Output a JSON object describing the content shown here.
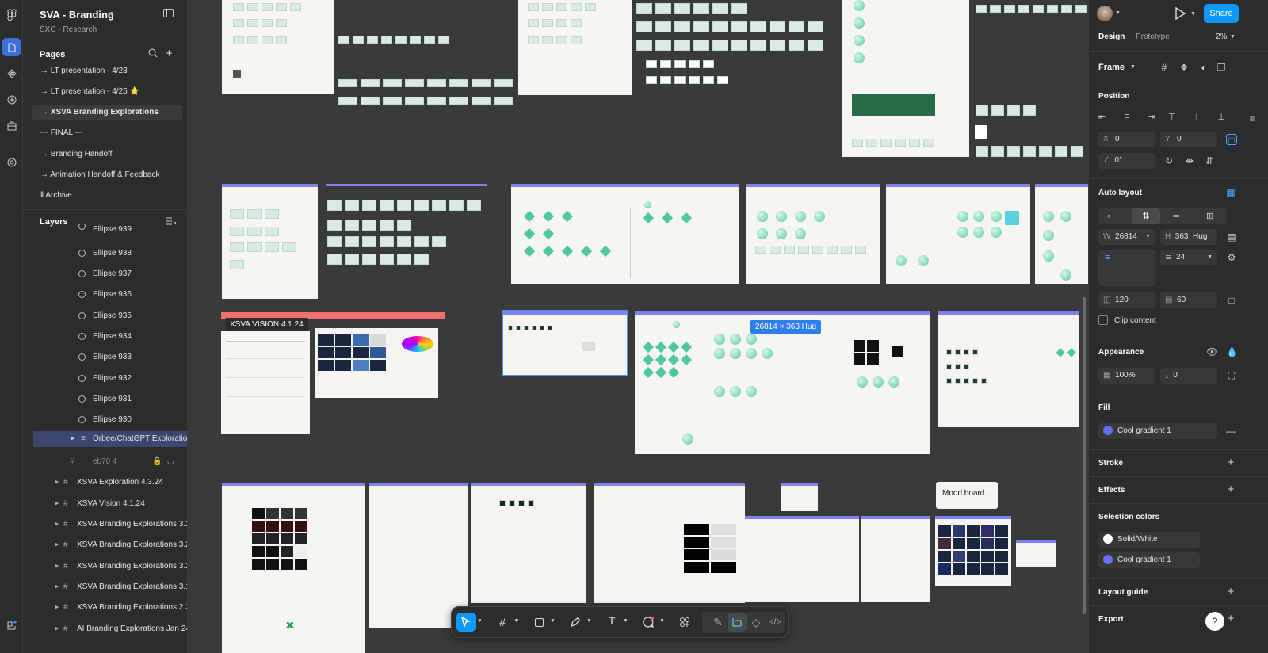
{
  "file": {
    "title": "SVA - Branding",
    "team": "SXC - Research"
  },
  "pages": {
    "header": "Pages",
    "items": [
      "→ LT presentation - 4/23",
      "→ LT presentation - 4/25 ⭐",
      "→ XSVA Branding Explorations",
      "--- FINAL ---",
      "→ Branding Handoff",
      "→ Animation Handoff & Feedback",
      "‖ Archive"
    ]
  },
  "layers": {
    "header": "Layers",
    "items": [
      "Ellipse 939",
      "Ellipse 938",
      "Ellipse 937",
      "Ellipse 936",
      "Ellipse 935",
      "Ellipse 934",
      "Ellipse 933",
      "Ellipse 932",
      "Ellipse 931",
      "Ellipse 930",
      "Orbee/ChatGPT Explorations",
      "eb70 4",
      "XSVA Exploration 4.3.24",
      "XSVA Vision 4.1.24",
      "XSVA Branding Explorations 3.2",
      "XSVA Branding Explorations 3.2",
      "XSVA Branding Explorations 3.2",
      "XSVA Branding Explorations 3.1",
      "XSVA Branding Explorations 2.2",
      "AI Branding Explorations Jan 24"
    ]
  },
  "canvas": {
    "vision_label": "XSVA VISION 4.1.24",
    "size_badge": "26814 × 363 Hug",
    "mood_label": "Mood board..."
  },
  "toolbar": {
    "tools": [
      "move-tool",
      "frame-tool",
      "shape-tool",
      "pen-tool",
      "text-tool",
      "comment-tool",
      "actions-tool",
      "draw-mode",
      "design-mode",
      "prototype-mode",
      "dev-mode"
    ]
  },
  "right": {
    "share": "Share",
    "tab_design": "Design",
    "tab_prototype": "Prototype",
    "zoom": "2%",
    "frame_label": "Frame",
    "position": "Position",
    "x_label": "X",
    "x": "0",
    "y_label": "Y",
    "y": "0",
    "rotation": "0°",
    "auto_layout": "Auto layout",
    "w_label": "W",
    "w": "26814",
    "h_label": "H",
    "h": "363",
    "h_mode": "Hug",
    "gap": "24",
    "pad_h": "120",
    "pad_v": "60",
    "clip": "Clip content",
    "appearance": "Appearance",
    "opacity": "100%",
    "radius": "0",
    "fill": "Fill",
    "fill_value": "Cool gradient 1",
    "stroke": "Stroke",
    "effects": "Effects",
    "selection_colors": "Selection colors",
    "sel_color_1": "Solid/White",
    "sel_color_2": "Cool gradient 1",
    "layout_guide": "Layout guide",
    "export": "Export",
    "help": "?"
  },
  "colors": {
    "accent": "#0d99ff",
    "gradient_start": "#8a5cf6",
    "gradient_end": "#4a7ef0",
    "frame_top": "#7f82ee",
    "vision_bar": "#f07070"
  }
}
